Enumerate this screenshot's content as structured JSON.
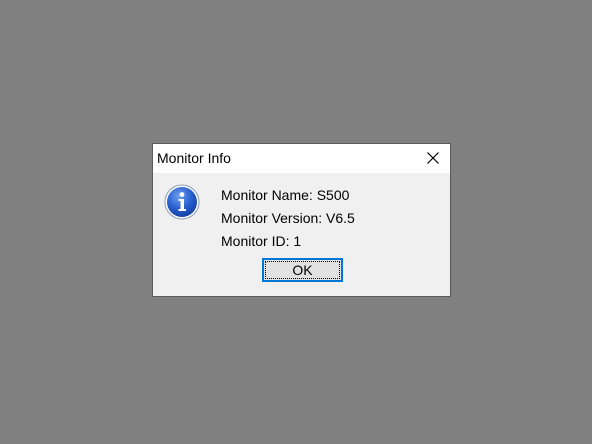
{
  "dialog": {
    "title": "Monitor Info",
    "close_icon": "close-icon",
    "info_icon": "information-icon",
    "lines": {
      "name": "Monitor Name: S500",
      "version": "Monitor Version: V6.5",
      "id": "Monitor ID: 1"
    },
    "ok_label": "OK"
  },
  "colors": {
    "desktop_background": "#808080",
    "dialog_background": "#f0f0f0",
    "titlebar_background": "#ffffff",
    "button_focus_border": "#0078d7",
    "info_icon_blue": "#1c4bb8"
  }
}
